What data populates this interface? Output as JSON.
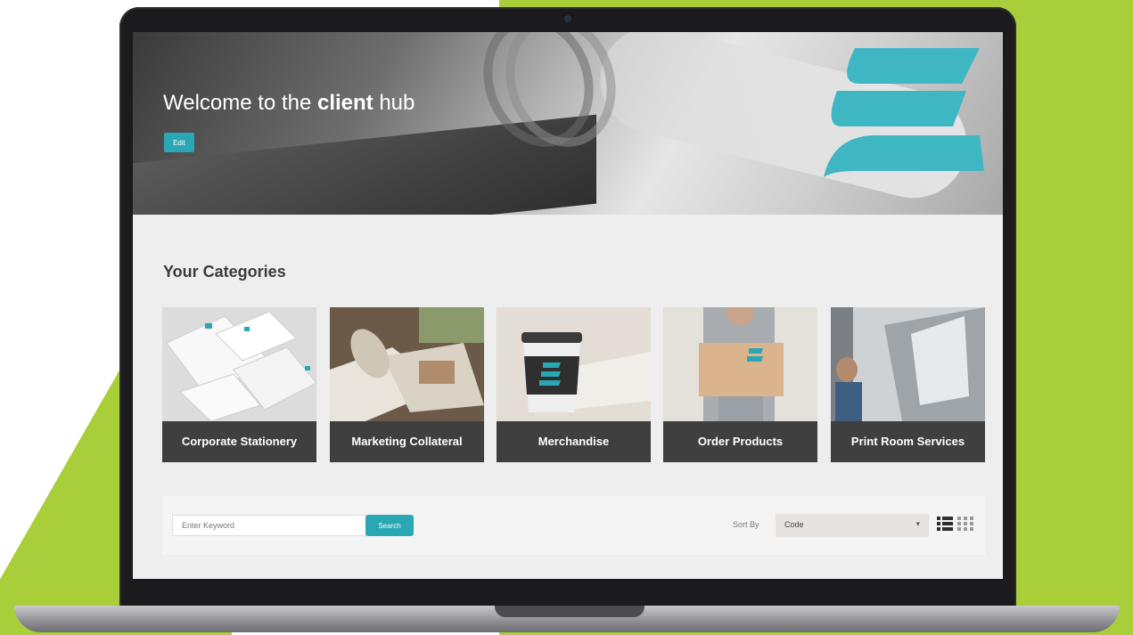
{
  "hero": {
    "title_pre": "Welcome to the ",
    "title_bold": "client",
    "title_post": " hub",
    "edit_label": "Edit"
  },
  "categories_title": "Your Categories",
  "categories": [
    {
      "label": "Corporate Stationery",
      "icon": "stationery-photo"
    },
    {
      "label": "Marketing Collateral",
      "icon": "brochures-photo"
    },
    {
      "label": "Merchandise",
      "icon": "coffee-cup-photo"
    },
    {
      "label": "Order Products",
      "icon": "box-delivery-photo"
    },
    {
      "label": "Print Room Services",
      "icon": "print-room-photo"
    }
  ],
  "search": {
    "placeholder": "Enter Keyword",
    "button_label": "Search"
  },
  "sort": {
    "label": "Sort By",
    "selected": "Code"
  },
  "colors": {
    "accent": "#2aa7b4",
    "brand_green": "#a8cf3a",
    "label_bg": "#3f3f3f"
  }
}
